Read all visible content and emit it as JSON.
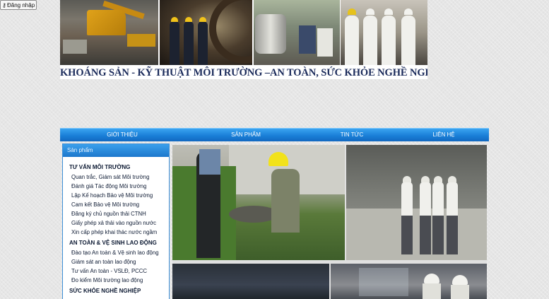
{
  "login": {
    "icon": "key-icon",
    "label": "Đăng nhập"
  },
  "banner": {
    "title": "KHOÁNG SẢN - KỸ THUẬT MÔI TRƯỜNG –AN TOÀN, SỨC KHỎE NGHỀ NGHIỆP"
  },
  "nav": {
    "items": [
      "GIỚI THIỆU",
      "SẢN PHẨM",
      "TIN TỨC",
      "LIÊN HỆ"
    ]
  },
  "sidebar": {
    "heading": "Sản phẩm",
    "groups": [
      {
        "title": "TƯ VẤN MÔI TRƯỜNG",
        "items": [
          "Quan trắc, Giám sát Môi trường",
          "Đánh giá Tác động Môi trường",
          "Lập Kế hoạch Bảo vệ Môi trường",
          "Cam kết Bảo vệ Môi trường",
          "Đăng ký chủ nguồn thải CTNH",
          "Giấy phép xả thải vào nguồn nước",
          "Xin cấp phép khai thác nước ngầm"
        ]
      },
      {
        "title": "AN TOÀN & VỆ SINH LAO ĐỘNG",
        "items": [
          "Đào tạo An toàn & Vệ sinh lao động",
          "Giám sát an toàn lao động",
          "Tư vấn An toàn - VSLĐ, PCCC",
          "Đo kiểm Môi trường lao động"
        ]
      },
      {
        "title": "SỨC KHỎE NGHỀ NGHIỆP",
        "items": []
      }
    ]
  },
  "colors": {
    "nav_blue": "#1a7fd8",
    "title_navy": "#1a2a5a",
    "page_bg": "#e6e6e6"
  }
}
